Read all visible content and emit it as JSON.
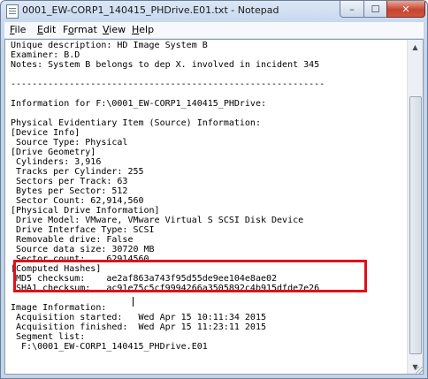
{
  "window": {
    "title": "0001_EW-CORP1_140415_PHDrive.E01.txt - Notepad",
    "icon": "notepad-icon",
    "controls": {
      "minimize": "–",
      "maximize": "☐",
      "close": "✕"
    }
  },
  "menu": {
    "items": [
      {
        "prefix": "",
        "mnemonic": "F",
        "rest": "ile"
      },
      {
        "prefix": "",
        "mnemonic": "E",
        "rest": "dit"
      },
      {
        "prefix": "F",
        "mnemonic": "o",
        "rest": "rmat"
      },
      {
        "prefix": "",
        "mnemonic": "V",
        "rest": "iew"
      },
      {
        "prefix": "",
        "mnemonic": "H",
        "rest": "elp"
      }
    ]
  },
  "document": {
    "lines": [
      "Unique description: HD Image System B",
      "Examiner: B.D",
      "Notes: System B belongs to dep X. involved in incident 345",
      "",
      "-----------------------------------------------------------",
      "",
      "Information for F:\\0001_EW-CORP1_140415_PHDrive:",
      "",
      "Physical Evidentiary Item (Source) Information:",
      "[Device Info]",
      " Source Type: Physical",
      "[Drive Geometry]",
      " Cylinders: 3,916",
      " Tracks per Cylinder: 255",
      " Sectors per Track: 63",
      " Bytes per Sector: 512",
      " Sector Count: 62,914,560",
      "[Physical Drive Information]",
      " Drive Model: VMware, VMware Virtual S SCSI Disk Device",
      " Drive Interface Type: SCSI",
      " Removable drive: False",
      " Source data size: 30720 MB",
      " Sector count:    62914560",
      "[Computed Hashes]",
      " MD5 checksum:    ae2af863a743f95d55de9ee104e8ae02",
      " SHA1 checksum:   ac91e75c5cf9994266a3505892c4b915dfde7e26",
      "",
      "Image Information:",
      " Acquisition started:   Wed Apr 15 10:11:34 2015",
      " Acquisition finished:  Wed Apr 15 11:23:11 2015",
      " Segment list:",
      "  F:\\0001_EW-CORP1_140415_PHDrive.E01"
    ]
  },
  "scrollbar": {
    "up": "▲",
    "down": "▼"
  },
  "colors": {
    "highlight_border": "#e0101a"
  }
}
